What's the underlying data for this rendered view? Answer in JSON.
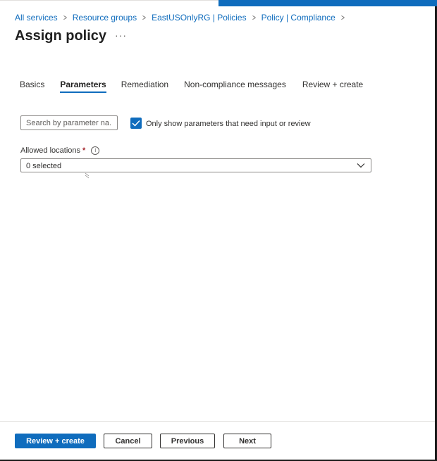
{
  "breadcrumb": {
    "items": [
      "All services",
      "Resource groups",
      "EastUSOnlyRG | Policies",
      "Policy | Compliance"
    ],
    "separator": ">"
  },
  "page": {
    "title": "Assign policy",
    "more_label": "···"
  },
  "tabs": [
    {
      "label": "Basics",
      "active": false
    },
    {
      "label": "Parameters",
      "active": true
    },
    {
      "label": "Remediation",
      "active": false
    },
    {
      "label": "Non-compliance messages",
      "active": false
    },
    {
      "label": "Review + create",
      "active": false
    }
  ],
  "filters": {
    "search_placeholder": "Search by parameter na...",
    "search_value": "",
    "only_show_label": "Only show parameters that need input or review",
    "only_show_checked": true
  },
  "parameters": {
    "allowed_locations": {
      "label": "Allowed locations",
      "required_marker": "*",
      "info_icon": "info-icon",
      "value": "0 selected",
      "dropdown_icon": "chevron-down-icon"
    }
  },
  "footer": {
    "review_create_label": "Review + create",
    "cancel_label": "Cancel",
    "previous_label": "Previous",
    "next_label": "Next"
  },
  "colors": {
    "accent": "#0f6cbd",
    "required": "#a4262c",
    "text": "#323130"
  }
}
